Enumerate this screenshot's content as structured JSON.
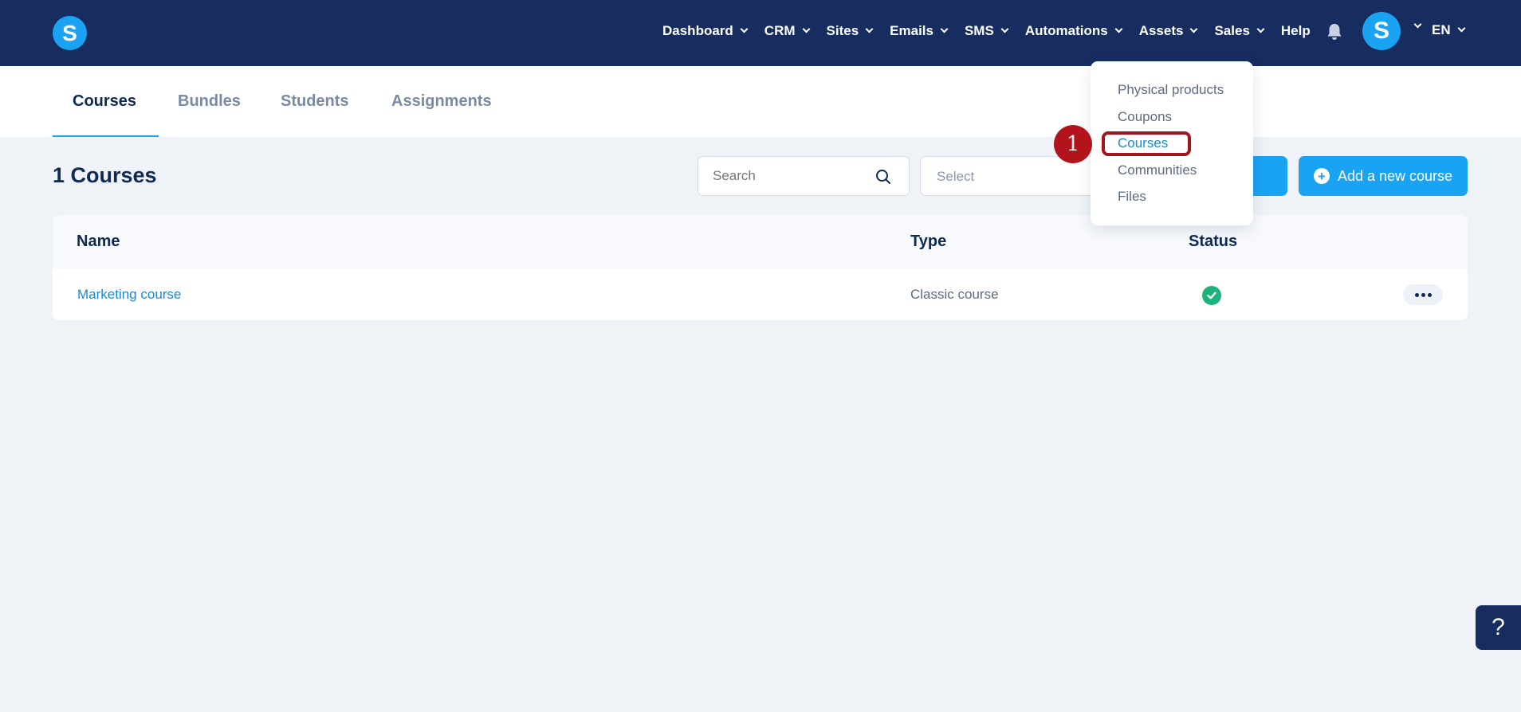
{
  "app": {
    "logo_letter": "S"
  },
  "nav": {
    "items": [
      {
        "label": "Dashboard",
        "has_dropdown": true
      },
      {
        "label": "CRM",
        "has_dropdown": true
      },
      {
        "label": "Sites",
        "has_dropdown": true
      },
      {
        "label": "Emails",
        "has_dropdown": true
      },
      {
        "label": "SMS",
        "has_dropdown": true
      },
      {
        "label": "Automations",
        "has_dropdown": true
      },
      {
        "label": "Assets",
        "has_dropdown": true
      },
      {
        "label": "Sales",
        "has_dropdown": true
      },
      {
        "label": "Help",
        "has_dropdown": false
      }
    ],
    "avatar_letter": "S",
    "language": "EN"
  },
  "tabs": [
    {
      "label": "Courses",
      "active": true
    },
    {
      "label": "Bundles",
      "active": false
    },
    {
      "label": "Students",
      "active": false
    },
    {
      "label": "Assignments",
      "active": false
    }
  ],
  "page": {
    "title": "1 Courses",
    "search_placeholder": "Search",
    "select_placeholder": "Select",
    "add_button_label": "Add a new course"
  },
  "table": {
    "columns": [
      "Name",
      "Type",
      "Status"
    ],
    "rows": [
      {
        "name": "Marketing course",
        "type": "Classic course",
        "status": "active"
      }
    ]
  },
  "assets_dropdown": {
    "items": [
      "Physical products",
      "Coupons",
      "Courses",
      "Communities",
      "Files"
    ],
    "selected": "Courses"
  },
  "annotation": {
    "step_number": "1"
  },
  "help_button": {
    "label": "?"
  },
  "colors": {
    "topbar": "#172d5f",
    "accent": "#1aa3f3",
    "link": "#1a8ad0",
    "status_ok": "#1bb37a",
    "annotation": "#b3141b",
    "background": "#eff3f8"
  }
}
